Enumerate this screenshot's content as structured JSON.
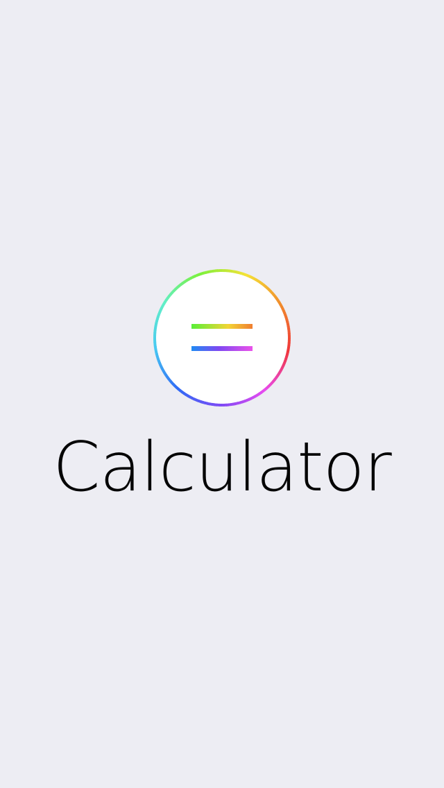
{
  "app": {
    "title": "Calculator"
  },
  "logo": {
    "icon": "equals-icon",
    "ring_colors": [
      "#7CF13B",
      "#F5E236",
      "#F08A2C",
      "#F0363B",
      "#E84BEF",
      "#7E4BF5",
      "#2F6BF5",
      "#49C9F2",
      "#62EFC7"
    ],
    "bar_top_colors": [
      "#58EF37",
      "#F2D535",
      "#F07E30"
    ],
    "bar_bottom_colors": [
      "#1F8BF3",
      "#7F48F1",
      "#EA52EA"
    ]
  },
  "colors": {
    "background": "#EDEDF3",
    "title": "#050505",
    "logo_fill": "#FFFFFF"
  }
}
